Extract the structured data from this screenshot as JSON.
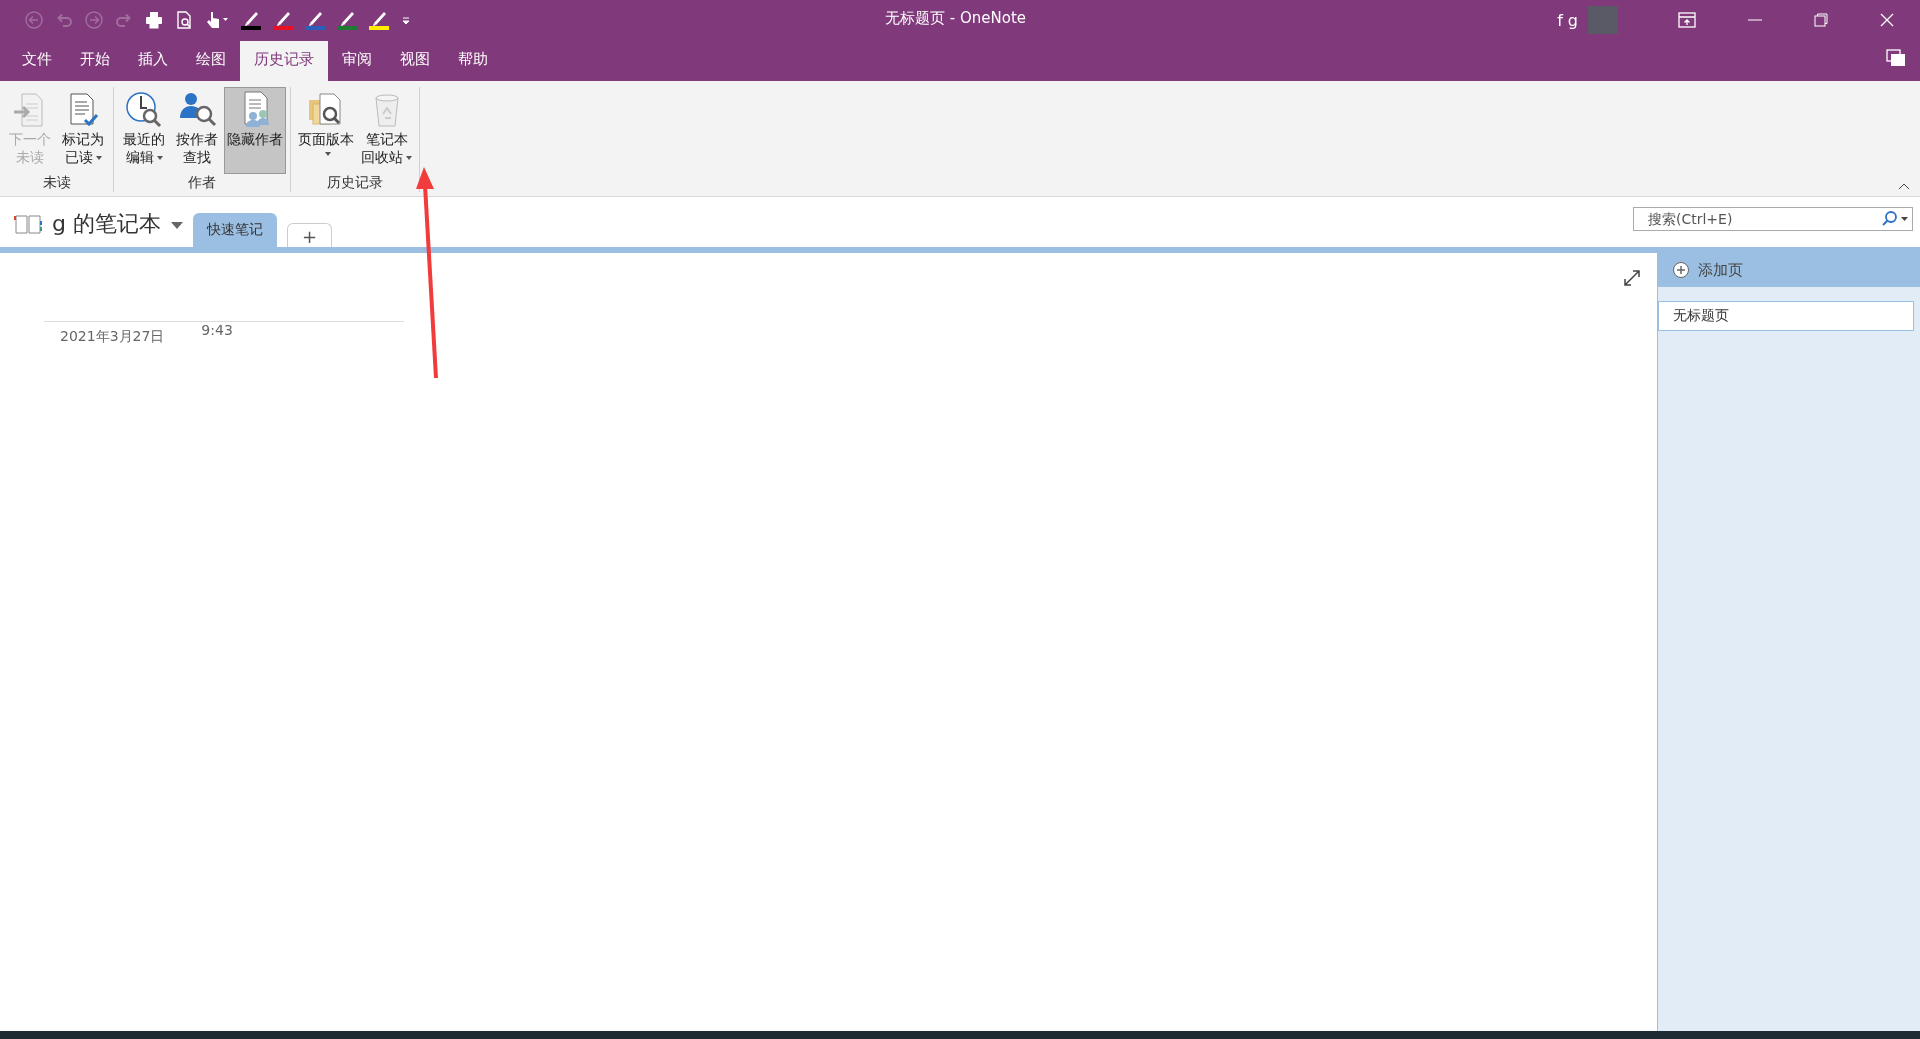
{
  "quick_access": [
    {
      "kind": "back",
      "disabled": true
    },
    {
      "kind": "undo",
      "disabled": true
    },
    {
      "kind": "forward",
      "disabled": true
    },
    {
      "kind": "redo",
      "disabled": true
    },
    {
      "kind": "print",
      "disabled": false
    },
    {
      "kind": "preview",
      "disabled": false
    },
    {
      "kind": "touch",
      "disabled": false
    },
    {
      "kind": "pen",
      "color": "#000000",
      "disabled": false
    },
    {
      "kind": "pen",
      "color": "#e81123",
      "disabled": false
    },
    {
      "kind": "pen",
      "color": "#2b5fb8",
      "disabled": false
    },
    {
      "kind": "pen",
      "color": "#1e7b34",
      "disabled": false
    },
    {
      "kind": "pen",
      "color": "#ffee00",
      "disabled": false
    },
    {
      "kind": "customize",
      "disabled": false
    }
  ],
  "window": {
    "title": "无标题页  -  OneNote",
    "user": "f g"
  },
  "menu_tabs": [
    {
      "label": "文件",
      "selected": false
    },
    {
      "label": "开始",
      "selected": false
    },
    {
      "label": "插入",
      "selected": false
    },
    {
      "label": "绘图",
      "selected": false
    },
    {
      "label": "历史记录",
      "selected": true
    },
    {
      "label": "审阅",
      "selected": false
    },
    {
      "label": "视图",
      "selected": false
    },
    {
      "label": "帮助",
      "selected": false
    }
  ],
  "ribbon_groups": [
    {
      "label": "未读",
      "buttons": [
        {
          "kind": "next-unread",
          "lines": [
            "下一个",
            "未读"
          ],
          "disabled": true,
          "dropdown": false,
          "pressed": false
        },
        {
          "kind": "mark-read",
          "lines": [
            "标记为",
            "已读"
          ],
          "disabled": false,
          "dropdown": true,
          "pressed": false
        }
      ]
    },
    {
      "label": "作者",
      "buttons": [
        {
          "kind": "recent",
          "lines": [
            "最近的",
            "编辑"
          ],
          "disabled": false,
          "dropdown": true,
          "pressed": false
        },
        {
          "kind": "find-author",
          "lines": [
            "按作者",
            "查找"
          ],
          "disabled": false,
          "dropdown": false,
          "pressed": false
        },
        {
          "kind": "hide-author",
          "lines": [
            "隐藏作者"
          ],
          "disabled": false,
          "dropdown": false,
          "pressed": true
        }
      ]
    },
    {
      "label": "历史记录",
      "buttons": [
        {
          "kind": "versions",
          "lines": [
            "页面版本"
          ],
          "disabled": false,
          "dropdown": true,
          "pressed": false
        },
        {
          "kind": "recycle",
          "lines": [
            "笔记本",
            "回收站"
          ],
          "disabled": false,
          "dropdown": true,
          "pressed": false
        }
      ]
    }
  ],
  "notebook": {
    "name": "g 的笔记本"
  },
  "sections": [
    {
      "label": "快速笔记",
      "selected": true
    }
  ],
  "add_section": "+",
  "search": {
    "placeholder": "搜索(Ctrl+E)"
  },
  "page": {
    "date": "2021年3月27日",
    "time": "9:43"
  },
  "pages_pane": {
    "add_page": "添加页",
    "pages": [
      {
        "title": "无标题页",
        "selected": true
      }
    ]
  }
}
